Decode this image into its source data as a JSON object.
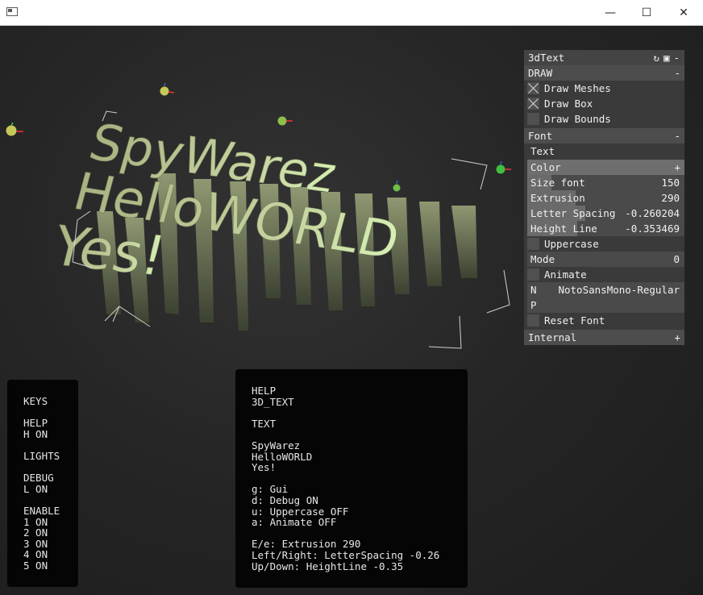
{
  "titlebar": {
    "minimize": "—",
    "maximize": "☐",
    "close": "✕"
  },
  "scene": {
    "lines": [
      "SpyWarez",
      "HelloWORLD",
      "Yes!"
    ]
  },
  "panel": {
    "title": "3dText",
    "title_icons": [
      "↻",
      "▣",
      "-"
    ],
    "draw": {
      "label": "DRAW",
      "toggle": "-",
      "items": [
        {
          "label": "Draw Meshes",
          "checked": true
        },
        {
          "label": "Draw Box",
          "checked": true
        },
        {
          "label": "Draw Bounds",
          "checked": false
        }
      ]
    },
    "font": {
      "label": "Font",
      "toggle": "-",
      "text_label": "Text",
      "color_label": "Color",
      "color_toggle": "+",
      "size_label": "Size font",
      "size_value": "150",
      "extrusion_label": "Extrusion",
      "extrusion_value": "290",
      "letter_spacing_label": "Letter Spacing",
      "letter_spacing_value": "-0.260204",
      "height_line_label": "Height Line",
      "height_line_value": "-0.353469",
      "uppercase_label": "Uppercase",
      "mode_label": "Mode",
      "mode_value": "0",
      "animate_label": "Animate",
      "name_key": "N",
      "name_value": "NotoSansMono-Regular",
      "p_key": "P",
      "reset_label": "Reset Font"
    },
    "internal": {
      "label": "Internal",
      "toggle": "+"
    }
  },
  "keys_box": {
    "lines": [
      "KEYS",
      "",
      "HELP",
      "H ON",
      "",
      "LIGHTS",
      "",
      "DEBUG",
      "L ON",
      "",
      "ENABLE",
      "1 ON",
      "2 ON",
      "3 ON",
      "4 ON",
      "5 ON"
    ]
  },
  "help_box": {
    "lines": [
      "HELP",
      "3D_TEXT",
      "",
      "TEXT",
      "",
      "SpyWarez",
      "HelloWORLD",
      "Yes!",
      "",
      "g: Gui",
      "d: Debug ON",
      "u: Uppercase OFF",
      "a: Animate OFF",
      "",
      "E/e: Extrusion 290",
      "Left/Right: LetterSpacing -0.26",
      "Up/Down: HeightLine -0.35"
    ]
  }
}
